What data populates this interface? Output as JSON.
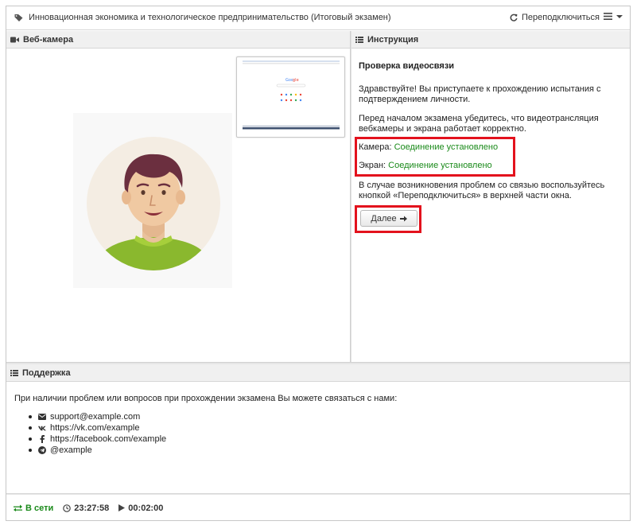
{
  "header": {
    "title": "Инновационная экономика и технологическое предпринимательство (Итоговый экзамен)",
    "reconnect_label": "Переподключиться"
  },
  "webcam": {
    "title": "Веб-камера"
  },
  "instructions": {
    "title": "Инструкция",
    "heading": "Проверка видеосвязи",
    "greeting": "Здравствуйте! Вы приступаете к прохождению испытания с подтверждением личности.",
    "check_text": "Перед началом экзамена убедитесь, что видеотрансляция вебкамеры и экрана работает корректно.",
    "camera_label": "Камера:",
    "camera_status": "Соединение установлено",
    "screen_label": "Экран:",
    "screen_status": "Соединение установлено",
    "help_text": "В случае возникновения проблем со связью воспользуйтесь кнопкой «Переподключиться» в верхней части окна.",
    "next_label": "Далее"
  },
  "support": {
    "title": "Поддержка",
    "intro": "При наличии проблем или вопросов при прохождении экзамена Вы можете связаться с нами:",
    "contacts": [
      {
        "icon": "envelope-icon",
        "text": "support@example.com"
      },
      {
        "icon": "vk-icon",
        "text": "https://vk.com/example"
      },
      {
        "icon": "facebook-icon",
        "text": "https://facebook.com/example"
      },
      {
        "icon": "telegram-icon",
        "text": "@example"
      }
    ]
  },
  "footer": {
    "status": "В сети",
    "clock": "23:27:58",
    "elapsed": "00:02:00"
  },
  "colors": {
    "ok_green": "#1a8a1a",
    "highlight_red": "#e3121d"
  }
}
